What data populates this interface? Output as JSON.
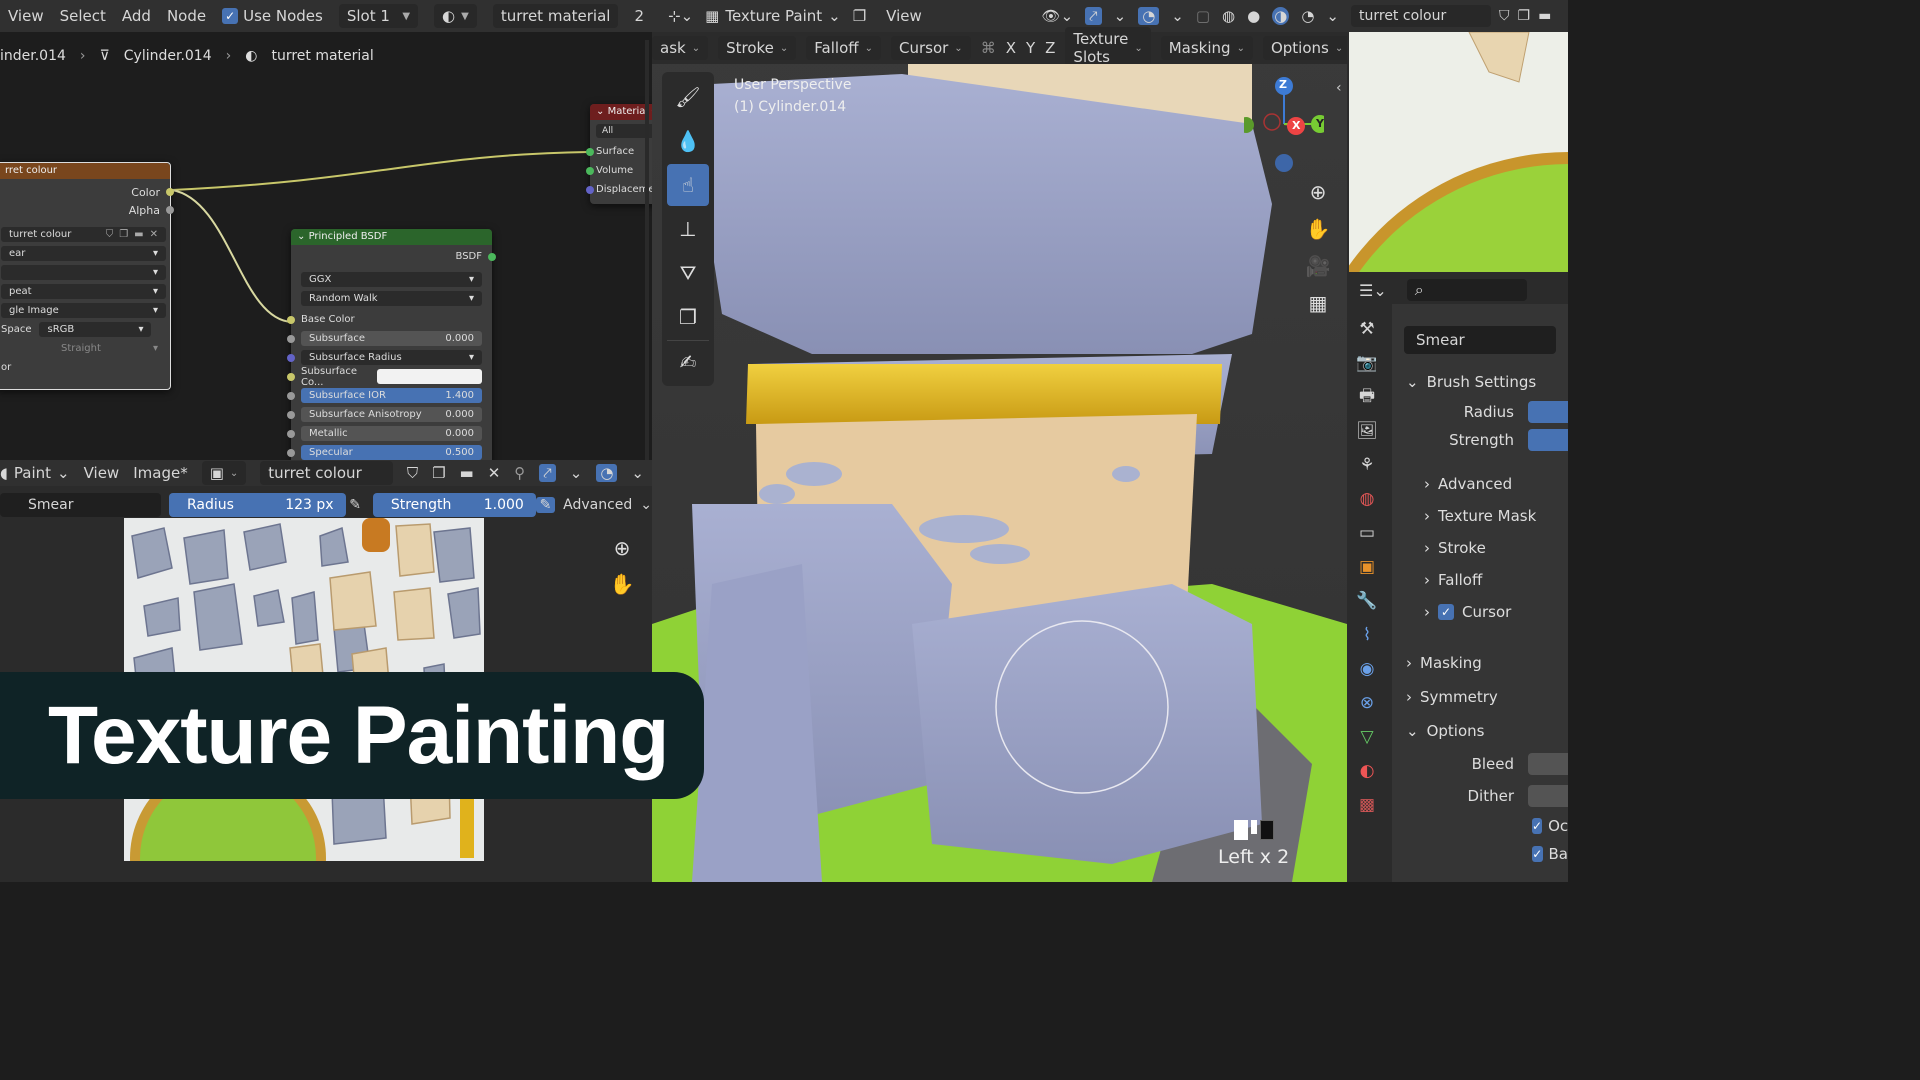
{
  "node_editor": {
    "header": {
      "view": "View",
      "select": "Select",
      "add": "Add",
      "node": "Node",
      "use_nodes": "Use Nodes",
      "slot": "Slot 1",
      "material": "turret material",
      "slot_num": "2"
    },
    "breadcrumb": {
      "object": "inder.014",
      "mesh": "Cylinder.014",
      "material": "turret material"
    },
    "image_node": {
      "title": "rret colour",
      "color": "Color",
      "alpha": "Alpha",
      "image": "turret colour",
      "interp": "ear",
      "extension": "peat",
      "source": "gle Image",
      "color_space_label": "Space",
      "color_space": "sRGB",
      "alpha_mode": "Straight",
      "vector": "or"
    },
    "output_node": {
      "title": "Material C",
      "target": "All",
      "surface": "Surface",
      "volume": "Volume",
      "displacement": "Displacemen"
    },
    "bsdf": {
      "title": "Principled BSDF",
      "output": "BSDF",
      "distribution": "GGX",
      "subsurface_method": "Random Walk",
      "base_color": "Base Color",
      "subsurface": "Subsurface",
      "subsurface_val": "0.000",
      "ss_radius": "Subsurface Radius",
      "ss_color": "Subsurface Co...",
      "ss_ior": "Subsurface IOR",
      "ss_ior_val": "1.400",
      "ss_aniso": "Subsurface Anisotropy",
      "ss_aniso_val": "0.000",
      "metallic": "Metallic",
      "metallic_val": "0.000",
      "specular": "Specular",
      "specular_val": "0.500"
    }
  },
  "image_editor": {
    "header": {
      "mode": "Paint",
      "view": "View",
      "image": "Image*",
      "image_name": "turret colour"
    },
    "tool": {
      "brush": "Smear",
      "radius_label": "Radius",
      "radius": "123 px",
      "strength_label": "Strength",
      "strength": "1.000",
      "advanced": "Advanced"
    }
  },
  "viewport": {
    "header": {
      "mode": "Texture Paint",
      "view": "View",
      "mask": "ask",
      "stroke": "Stroke",
      "falloff": "Falloff",
      "cursor": "Cursor",
      "x": "X",
      "y": "Y",
      "z": "Z",
      "slots": "Texture Slots",
      "masking": "Masking",
      "options": "Options"
    },
    "overlay": {
      "perspective": "User Perspective",
      "object": "(1) Cylinder.014"
    },
    "gizmo": {
      "z": "Z",
      "x": "X",
      "y": "Y"
    },
    "status": "Left x 2"
  },
  "properties": {
    "image_name": "turret colour",
    "brush": "Smear",
    "brush_settings": "Brush Settings",
    "radius": "Radius",
    "strength": "Strength",
    "advanced": "Advanced",
    "texture_mask": "Texture Mask",
    "stroke": "Stroke",
    "falloff": "Falloff",
    "cursor": "Cursor",
    "masking": "Masking",
    "symmetry": "Symmetry",
    "options": "Options",
    "bleed": "Bleed",
    "dither": "Dither",
    "occlude": "Oc",
    "backface": "Ba"
  },
  "banner": {
    "title": "Texture Painting"
  },
  "colors": {
    "accent": "#4772b3",
    "panel": "#303030",
    "node_image": "#79461d",
    "node_shader": "#2b652b"
  }
}
